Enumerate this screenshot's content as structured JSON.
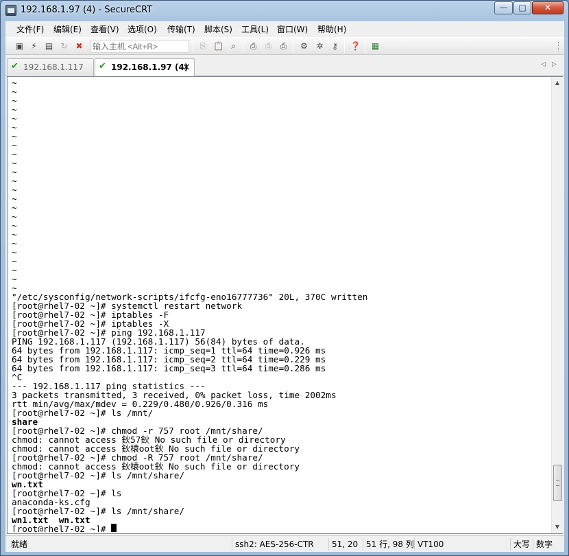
{
  "window": {
    "title": "192.168.1.97 (4) - SecureCRT",
    "buttons": {
      "minimize": "—",
      "maximize": "□",
      "close": "✕"
    }
  },
  "menu": [
    "文件(F)",
    "编辑(E)",
    "查看(V)",
    "选项(O)",
    "传输(T)",
    "脚本(S)",
    "工具(L)",
    "窗口(W)",
    "帮助(H)"
  ],
  "toolbar": {
    "host_placeholder": "输入主机 <Alt+R>",
    "icons": [
      "connect-icon",
      "quick-connect-icon",
      "connect-tab-icon",
      "reconnect-icon",
      "disconnect-icon",
      "copy-icon",
      "paste-icon",
      "find-icon",
      "print-icon",
      "print-selection-icon",
      "print-setup-icon",
      "session-options-icon",
      "global-options-icon",
      "keymap-icon",
      "help-icon",
      "sftp-icon"
    ]
  },
  "tabs": [
    {
      "label": "192.168.1.117 (2)",
      "active": false
    },
    {
      "label": "192.168.1.97 (4)",
      "active": true,
      "close": "×"
    }
  ],
  "tab_nav": {
    "left": "◁",
    "right": "▷"
  },
  "terminal": {
    "lines": [
      {
        "t": "~"
      },
      {
        "t": "~"
      },
      {
        "t": "~"
      },
      {
        "t": "~"
      },
      {
        "t": "~"
      },
      {
        "t": "~"
      },
      {
        "t": "~"
      },
      {
        "t": "~"
      },
      {
        "t": "~"
      },
      {
        "t": "~"
      },
      {
        "t": "~"
      },
      {
        "t": "~"
      },
      {
        "t": "~"
      },
      {
        "t": "~"
      },
      {
        "t": "~"
      },
      {
        "t": "~"
      },
      {
        "t": "~"
      },
      {
        "t": "~"
      },
      {
        "t": "~"
      },
      {
        "t": "~"
      },
      {
        "t": "~"
      },
      {
        "t": "~"
      },
      {
        "t": "~"
      },
      {
        "t": "~"
      },
      {
        "t": "\"/etc/sysconfig/network-scripts/ifcfg-eno16777736\" 20L, 370C written"
      },
      {
        "t": "[root@rhel7-02 ~]# systemctl restart network"
      },
      {
        "t": "[root@rhel7-02 ~]# iptables -F"
      },
      {
        "t": "[root@rhel7-02 ~]# iptables -X"
      },
      {
        "t": "[root@rhel7-02 ~]# ping 192.168.1.117"
      },
      {
        "t": "PING 192.168.1.117 (192.168.1.117) 56(84) bytes of data."
      },
      {
        "t": "64 bytes from 192.168.1.117: icmp_seq=1 ttl=64 time=0.926 ms"
      },
      {
        "t": "64 bytes from 192.168.1.117: icmp_seq=2 ttl=64 time=0.229 ms"
      },
      {
        "t": "64 bytes from 192.168.1.117: icmp_seq=3 ttl=64 time=0.286 ms"
      },
      {
        "t": "^C"
      },
      {
        "t": "--- 192.168.1.117 ping statistics ---"
      },
      {
        "t": "3 packets transmitted, 3 received, 0% packet loss, time 2002ms"
      },
      {
        "t": "rtt min/avg/max/mdev = 0.229/0.480/0.926/0.316 ms"
      },
      {
        "t": "[root@rhel7-02 ~]# ls /mnt/"
      },
      {
        "t": "share",
        "bold": true
      },
      {
        "t": "[root@rhel7-02 ~]# chmod -r 757 root /mnt/share/"
      },
      {
        "t": "chmod: cannot access 鈥57鈥 No such file or directory"
      },
      {
        "t": "chmod: cannot access 鈥榬oot鈥 No such file or directory"
      },
      {
        "t": "[root@rhel7-02 ~]# chmod -R 757 root /mnt/share/"
      },
      {
        "t": "chmod: cannot access 鈥榬oot鈥 No such file or directory"
      },
      {
        "t": "[root@rhel7-02 ~]# ls /mnt/share/"
      },
      {
        "t": "wn.txt",
        "bold": true
      },
      {
        "t": "[root@rhel7-02 ~]# ls"
      },
      {
        "t": "anaconda-ks.cfg"
      },
      {
        "t": "[root@rhel7-02 ~]# ls /mnt/share/"
      },
      {
        "t": "wn1.txt  wn.txt",
        "bold": true
      },
      {
        "t": "[root@rhel7-02 ~]# █"
      }
    ]
  },
  "scrollbar": {
    "up": "▲",
    "down": "▼",
    "position": 0.95
  },
  "status": {
    "ready": "就绪",
    "protocol": "ssh2: AES-256-CTR",
    "cursor": "51,  20",
    "size": "51 行, 98 列",
    "terminal_type": "VT100",
    "caps": "大写",
    "num": "数字"
  }
}
